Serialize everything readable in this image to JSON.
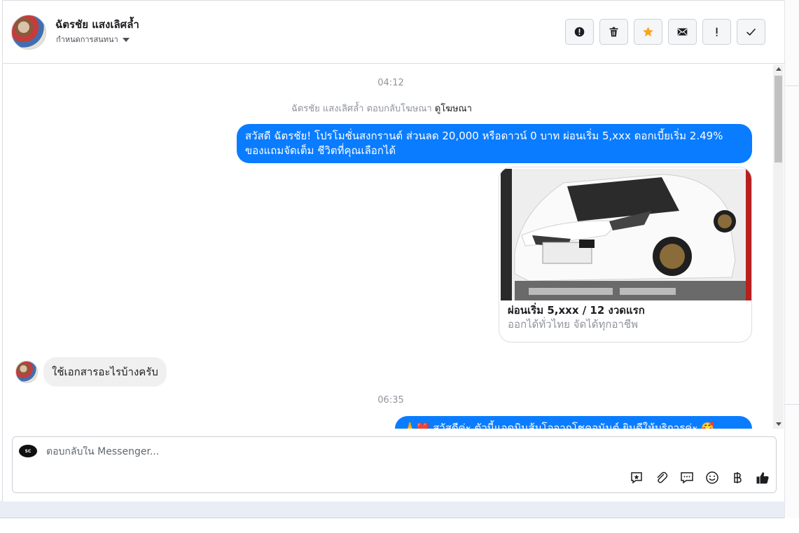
{
  "contact": {
    "name": "ฉัตรชัย แสงเลิศล้ำ",
    "assign_label": "กำหนดการสนทนา"
  },
  "toolbar": {
    "buttons": [
      "spam-icon",
      "trash-icon",
      "star-icon",
      "mail-icon",
      "exclamation-icon",
      "check-icon"
    ],
    "star_color": "#f5a623"
  },
  "thread": {
    "time1": "04:12",
    "reply_note": "ฉัตรชัย แสงเลิศล้ำ ตอบกลับโฆษณา",
    "reply_link": "ดูโฆษณา",
    "msg1": "สวัสดี ฉัตรชัย! โปรโมชั่นสงกรานต์ ส่วนลด 20,000 หรือดาวน์ 0 บาท ผ่อนเริ่ม 5,xxx ดอกเบี้ยเริ่ม 2.49% ของแถมจัดเต็ม ชีวิตที่คุณเลือกได้",
    "card_title": "ผ่อนเริ่ม 5,xxx / 12 งวดแรก",
    "card_subtitle": "ออกได้ทั่วไทย จัดได้ทุกอาชีพ",
    "msg2": "ใช้เอกสารอะไรบ้างครับ",
    "time2": "06:35",
    "msg3_partial": "🙏❤️ สวัสดีค่ะ ตัวนี้แอดมินส้มโอจากโชคอนันต์ ยินดีให้บริการค่ะ 🥰"
  },
  "composer": {
    "placeholder": "ตอบกลับใน Messenger...",
    "page_logo_text": "SC"
  },
  "colors": {
    "accent": "#0a7cff"
  }
}
